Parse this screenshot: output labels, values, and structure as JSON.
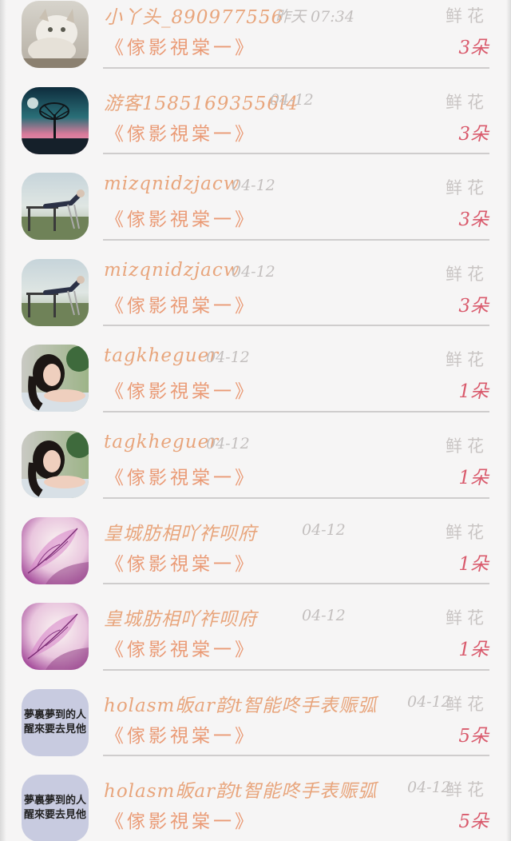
{
  "gift_list": [
    {
      "avatar": "cat-photo",
      "name": "小丫头_890977556",
      "time": "昨天 07:34",
      "gift": "鲜花",
      "subtitle": "《傢影視棠一》",
      "count": "3朵"
    },
    {
      "avatar": "tree-night-photo",
      "name": "游客15851693556l4",
      "time": "04-12",
      "gift": "鲜花",
      "subtitle": "《傢影視棠一》",
      "count": "3朵"
    },
    {
      "avatar": "person-reclining-photo",
      "name": "mizqnidzjacw",
      "time": "04-12",
      "gift": "鲜花",
      "subtitle": "《傢影視棠一》",
      "count": "3朵"
    },
    {
      "avatar": "person-reclining-photo",
      "name": "mizqnidzjacw",
      "time": "04-12",
      "gift": "鲜花",
      "subtitle": "《傢影視棠一》",
      "count": "3朵"
    },
    {
      "avatar": "girl-portrait-photo",
      "name": "tagkheguer",
      "time": "04-12",
      "gift": "鲜花",
      "subtitle": "《傢影視棠一》",
      "count": "1朵"
    },
    {
      "avatar": "girl-portrait-photo",
      "name": "tagkheguer",
      "time": "04-12",
      "gift": "鲜花",
      "subtitle": "《傢影視棠一》",
      "count": "1朵"
    },
    {
      "avatar": "pink-leaf-photo",
      "name": "皇城肪相吖祚呗府",
      "time": "04-12",
      "gift": "鲜花",
      "subtitle": "《傢影視棠一》",
      "count": "1朵"
    },
    {
      "avatar": "pink-leaf-photo",
      "name": "皇城肪相吖祚呗府",
      "time": "04-12",
      "gift": "鲜花",
      "subtitle": "《傢影視棠一》",
      "count": "1朵"
    },
    {
      "avatar": "calligraphy-text",
      "avatar_text": [
        "夢裏夢到的人",
        "醒來要去見他"
      ],
      "name": "holasm皈ar韵t智能咚手表赈弧",
      "time": "04-12",
      "gift": "鲜花",
      "subtitle": "《傢影視棠一》",
      "count": "5朵"
    },
    {
      "avatar": "calligraphy-text",
      "avatar_text": [
        "夢裏夢到的人",
        "醒來要去見他"
      ],
      "name": "holasm皈ar韵t智能咚手表赈弧",
      "time": "04-12",
      "gift": "鲜花",
      "subtitle": "《傢影視棠一》",
      "count": "5朵"
    }
  ]
}
